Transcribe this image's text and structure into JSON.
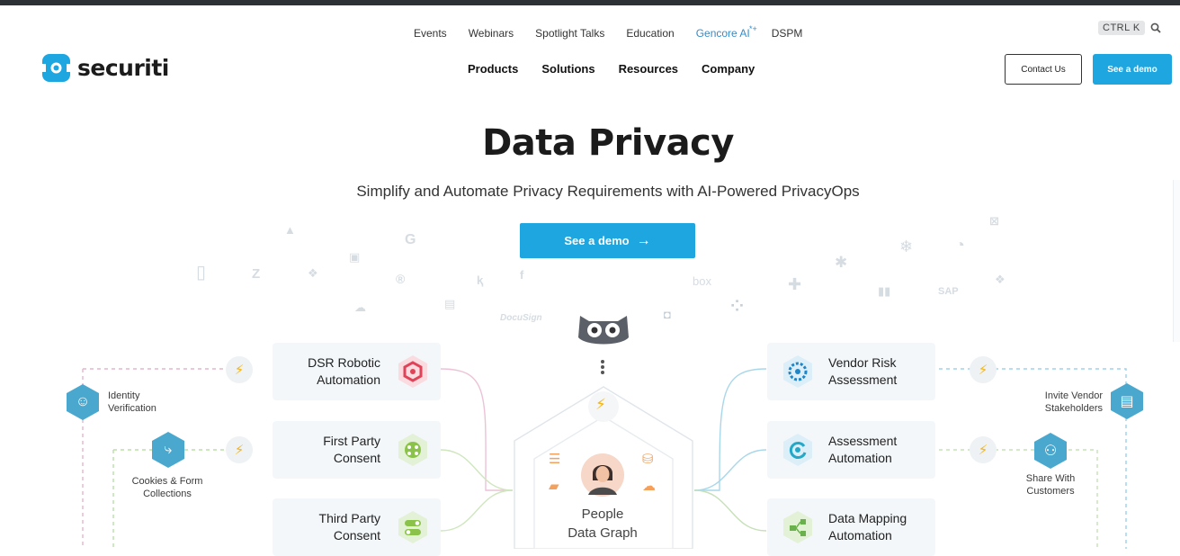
{
  "brand": {
    "name": "securiti"
  },
  "utility_nav": [
    {
      "label": "Events"
    },
    {
      "label": "Webinars"
    },
    {
      "label": "Spotlight Talks"
    },
    {
      "label": "Education"
    },
    {
      "label": "Gencore AI",
      "badge": "*+"
    },
    {
      "label": "DSPM"
    }
  ],
  "main_nav": [
    {
      "label": "Products"
    },
    {
      "label": "Solutions"
    },
    {
      "label": "Resources"
    },
    {
      "label": "Company"
    }
  ],
  "search": {
    "shortcut": "CTRL K",
    "icon": "search-icon"
  },
  "header_buttons": {
    "contact": "Contact Us",
    "demo": "See a demo"
  },
  "hero": {
    "title": "Data Privacy",
    "subtitle": "Simplify and Automate Privacy Requirements with AI-Powered PrivacyOps",
    "cta": "See a demo",
    "cta_icon": "→"
  },
  "bg_logos": [
    "box",
    "DocuSign",
    "SAP"
  ],
  "left_cards": [
    {
      "line1": "DSR Robotic",
      "line2": "Automation",
      "icon": "robot-hex-icon",
      "color": "#e04357"
    },
    {
      "line1": "First Party",
      "line2": "Consent",
      "icon": "consent-dots-icon",
      "color": "#8bc34a"
    },
    {
      "line1": "Third Party",
      "line2": "Consent",
      "icon": "toggle-icon",
      "color": "#8bc34a"
    }
  ],
  "right_cards": [
    {
      "line1": "Vendor Risk",
      "line2": "Assessment",
      "icon": "gauge-icon",
      "color": "#1e86c8"
    },
    {
      "line1": "Assessment",
      "line2": "Automation",
      "icon": "refresh-gauge-icon",
      "color": "#23a8c8"
    },
    {
      "line1": "Data Mapping",
      "line2": "Automation",
      "icon": "network-icon",
      "color": "#6ab04c"
    }
  ],
  "left_side": [
    {
      "line1": "Identity",
      "line2": "Verification",
      "icon": "identity-icon"
    },
    {
      "line1": "Cookies & Form",
      "line2": "Collections",
      "icon": "cookie-flow-icon"
    }
  ],
  "right_side": [
    {
      "line1": "Invite Vendor",
      "line2": "Stakeholders",
      "icon": "invite-icon"
    },
    {
      "line1": "Share With",
      "line2": "Customers",
      "icon": "share-icon"
    }
  ],
  "center": {
    "line1": "People",
    "line2": "Data Graph"
  },
  "colors": {
    "accent": "#1ea6e0",
    "bolt": "#f2b51a",
    "side_hex": "#4aa8cf"
  }
}
